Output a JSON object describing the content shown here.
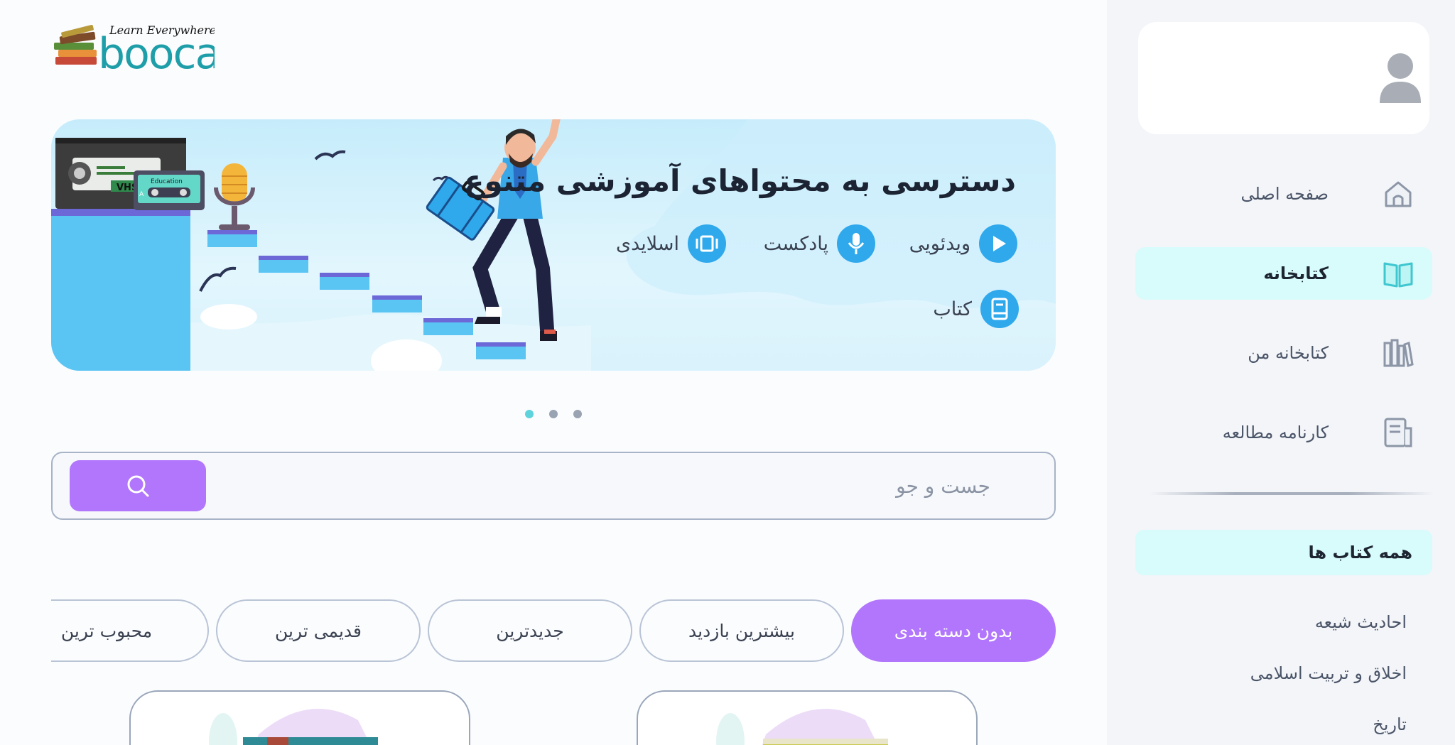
{
  "logo": {
    "tagline": "Learn Everywhere",
    "brand": "booca"
  },
  "sidebar": {
    "items": [
      {
        "label": "صفحه اصلی",
        "icon": "home-icon",
        "active": false
      },
      {
        "label": "کتابخانه",
        "icon": "open-book-icon",
        "active": true
      },
      {
        "label": "کتابخانه من",
        "icon": "bookshelf-icon",
        "active": false
      },
      {
        "label": "کارنامه مطالعه",
        "icon": "report-icon",
        "active": false
      }
    ],
    "all_books": "همه کتاب ها",
    "categories": [
      "احادیث شیعه",
      "اخلاق و تربیت اسلامی",
      "تاریخ"
    ]
  },
  "banner": {
    "title": "دسترسی به محتواهای آموزشی متنوع",
    "features": [
      {
        "label": "ویدئویی",
        "icon": "play-icon"
      },
      {
        "label": "پادکست",
        "icon": "microphone-icon"
      },
      {
        "label": "اسلایدی",
        "icon": "slides-icon"
      },
      {
        "label": "کتاب",
        "icon": "book-icon"
      }
    ],
    "vhs_label": "VHS",
    "cassette_label": "Education",
    "cassette_side": "A"
  },
  "carousel": {
    "total": 3,
    "active_index": 0
  },
  "search": {
    "placeholder": "جست و جو",
    "value": ""
  },
  "filters": [
    "بدون دسته بندی",
    "بیشترین بازدید",
    "جدیدترین",
    "قدیمی ترین",
    "محبوب ترین"
  ],
  "colors": {
    "accent": "#b176fb",
    "active_bg": "#d8fbfb",
    "banner_icon": "#2fa9ec",
    "dot_active": "#5fd3dc",
    "dot_inactive": "#9aa3b2"
  }
}
